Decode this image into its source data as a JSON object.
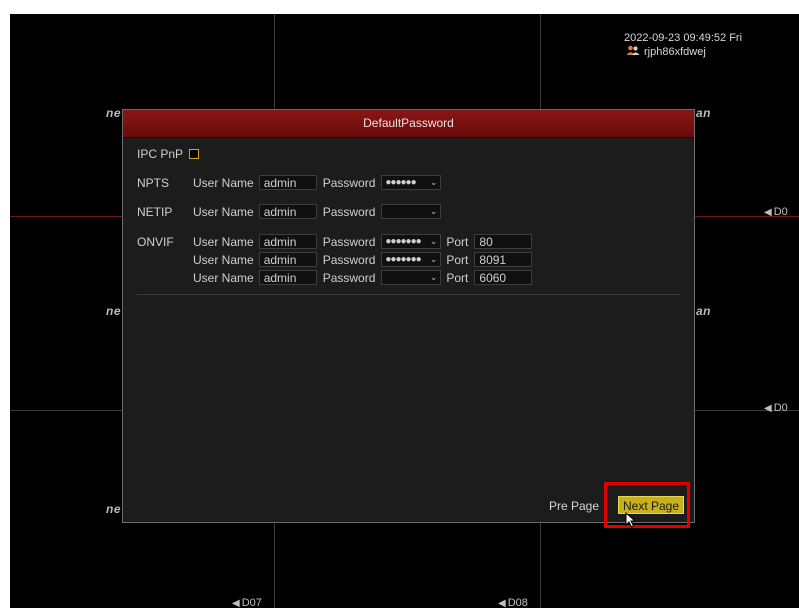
{
  "status": {
    "datetime": "2022-09-23 09:49:52 Fri",
    "user": "rjph86xfdwej",
    "user_icon": "users-icon"
  },
  "background": {
    "logo_fragments": [
      "ne",
      "ne",
      "ne",
      "an",
      "an"
    ],
    "channels": [
      "D07",
      "D08",
      "D0",
      "D0"
    ],
    "camera_icon": "camera-icon"
  },
  "dialog": {
    "title": "DefaultPassword",
    "ipc_pnp_label": "IPC PnP",
    "ipc_pnp_checked": false,
    "protocols": {
      "npts": {
        "label": "NPTS",
        "user_label": "User Name",
        "user": "admin",
        "password_label": "Password",
        "password_mask": "●●●●●●"
      },
      "netip": {
        "label": "NETIP",
        "user_label": "User Name",
        "user": "admin",
        "password_label": "Password",
        "password_mask": ""
      },
      "onvif": {
        "label": "ONVIF",
        "rows": [
          {
            "user_label": "User Name",
            "user": "admin",
            "password_label": "Password",
            "password_mask": "●●●●●●●",
            "port_label": "Port",
            "port": "80"
          },
          {
            "user_label": "User Name",
            "user": "admin",
            "password_label": "Password",
            "password_mask": "●●●●●●●",
            "port_label": "Port",
            "port": "8091"
          },
          {
            "user_label": "User Name",
            "user": "admin",
            "password_label": "Password",
            "password_mask": "",
            "port_label": "Port",
            "port": "6060"
          }
        ]
      }
    },
    "buttons": {
      "pre_page": "Pre Page",
      "next_page": "Next Page"
    },
    "highlight_color": "#e10000",
    "accent_color": "#c9b01e",
    "titlebar_color": "#7a1010"
  }
}
